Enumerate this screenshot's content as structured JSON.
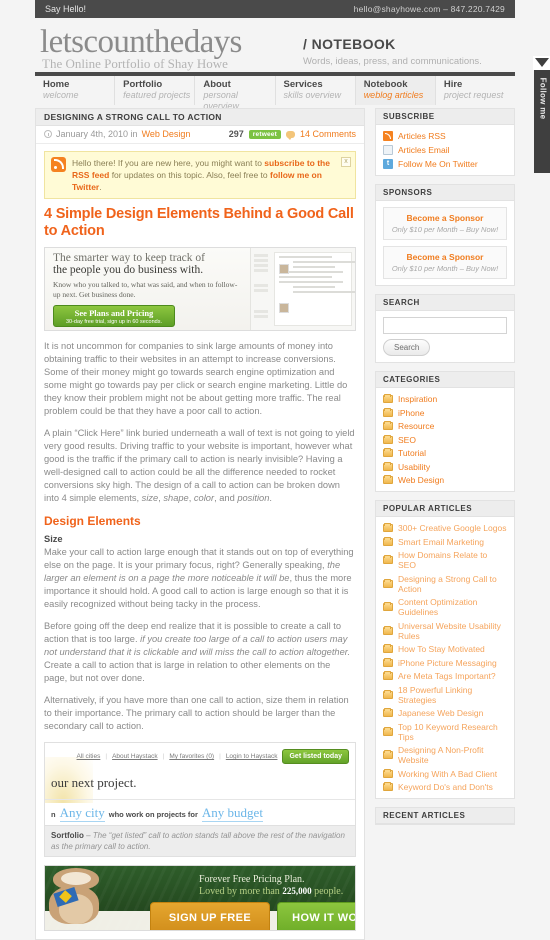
{
  "topbar": {
    "hello": "Say Hello!",
    "contact": "hello@shayhowe.com  –  847.220.7429"
  },
  "masthead": {
    "brand": "letscounthedays",
    "tagline": "The Online Portfolio of Shay Howe",
    "section": "/ NOTEBOOK",
    "section_desc": "Words, ideas, press, and communications."
  },
  "nav": {
    "items": [
      {
        "title": "Home",
        "sub": "welcome",
        "active": false
      },
      {
        "title": "Portfolio",
        "sub": "featured projects",
        "active": false
      },
      {
        "title": "About",
        "sub": "personal overview",
        "active": false
      },
      {
        "title": "Services",
        "sub": "skills overview",
        "active": false
      },
      {
        "title": "Notebook",
        "sub": "weblog articles",
        "active": true
      },
      {
        "title": "Hire",
        "sub": "project request",
        "active": false
      }
    ]
  },
  "follow_tab": {
    "label": "Follow me",
    "icon": "twitter-bird-icon"
  },
  "article": {
    "breadcrumb_title": "DESIGNING A STRONG CALL TO ACTION",
    "date": "January 4th, 2010 in",
    "category": "Web Design",
    "retweet_count": "297",
    "retweet_label": "retweet",
    "comments": "14 Comments",
    "rss_notice_pre": "Hello there! If you are new here, you might want to ",
    "rss_notice_link1": "subscribe to the RSS feed",
    "rss_notice_mid": " for updates on this topic. Also, feel free to ",
    "rss_notice_link2": "follow me on Twitter",
    "rss_notice_end": ".",
    "rss_close": "x",
    "title": "4 Simple Design Elements Behind a Good Call to Action",
    "hero": {
      "headline_dim": "The smarter way to keep track of",
      "headline": "the people you do business with.",
      "paragraph": "Know who you talked to, what was said, and when to follow-up next. Get business done.",
      "cta_title": "See Plans and Pricing",
      "cta_sub": "30-day free trial, sign up in 60 seconds."
    },
    "p1": "It is not uncommon for companies to sink large amounts of money into obtaining traffic to their websites in an attempt to increase conversions. Some of their money might go towards search engine optimization and some might go towards pay per click or search engine marketing. Little do they know their problem might not be about getting more traffic. The real problem could be that they have a poor call to action.",
    "p2_a": "A plain “Click Here” link buried underneath a wall of text is not going to yield very good results. Driving traffic to your website is important, however what good is the traffic if the primary call to action is nearly invisible? Having a well-designed call to action could be all the difference needed to rocket conversions sky high. The design of a call to action can be broken down into 4 simple elements, ",
    "p2_i1": "size",
    "p2_c1": ", ",
    "p2_i2": "shape",
    "p2_c2": ", ",
    "p2_i3": "color",
    "p2_c3": ", and ",
    "p2_i4": "position",
    "p2_end": ".",
    "h2_design_elements": "Design Elements",
    "h3_size": "Size",
    "p3_a": "Make your call to action large enough that it stands out on top of everything else on the page. It is your primary focus, right? Generally speaking, ",
    "p3_i": "the larger an element is on a page the more noticeable it will be",
    "p3_b": ", thus the more importance it should hold. A good call to action is large enough so that it is easily recognized without being tacky in the process.",
    "p4_a": "Before going off the deep end realize that it is possible to create a call to action that is too large. ",
    "p4_i": "if you create too large of a call to action users may not understand that it is clickable and will miss the call to action altogether.",
    "p4_b": " Create a call to action that is large in relation to other elements on the page, but not over done.",
    "p5": "Alternatively, if you have more than one call to action, size them in relation to their importance. The primary call to action should be larger than the secondary call to action.",
    "haystack": {
      "links": [
        "All cities",
        "About Haystack",
        "My favorites (0)",
        "Login to Haystack"
      ],
      "button": "Get listed today",
      "headline": "our next project.",
      "pre": "n",
      "blue1": "Any city",
      "mid": "who work on projects for",
      "blue2": "Any budget",
      "caption_strong": "Sortfolio",
      "caption_rest": " – The “get listed” call to action stands tall above the rest of the navigation as the primary call to action."
    },
    "mailchimp": {
      "line1": "Forever Free Pricing Plan.",
      "line2_pre": "Loved by more than ",
      "line2_num": "225,000",
      "line2_post": " people.",
      "btn1": "SIGN UP FREE",
      "btn2": "HOW IT WORKS"
    }
  },
  "sidebar": {
    "subscribe": {
      "title": "SUBSCRIBE",
      "items": [
        {
          "label": "Articles RSS",
          "icon": "rss-icon"
        },
        {
          "label": "Articles Email",
          "icon": "mail-icon"
        },
        {
          "label": "Follow Me On Twitter",
          "icon": "twitter-icon"
        }
      ]
    },
    "sponsors": {
      "title": "SPONSORS",
      "items": [
        {
          "title": "Become a Sponsor",
          "sub": "Only $10 per Month – Buy Now!"
        },
        {
          "title": "Become a Sponsor",
          "sub": "Only $10 per Month – Buy Now!"
        }
      ]
    },
    "search": {
      "title": "SEARCH",
      "value": "",
      "placeholder": "",
      "button": "Search"
    },
    "categories": {
      "title": "CATEGORIES",
      "items": [
        "Inspiration",
        "iPhone",
        "Resource",
        "SEO",
        "Tutorial",
        "Usability",
        "Web Design"
      ]
    },
    "popular": {
      "title": "POPULAR ARTICLES",
      "items": [
        "300+ Creative Google Logos",
        "Smart Email Marketing",
        "How Domains Relate to SEO",
        "Designing a Strong Call to Action",
        "Content Optimization Guidelines",
        "Universal Website Usability Rules",
        "How To Stay Motivated",
        "iPhone Picture Messaging",
        "Are Meta Tags Important?",
        "18 Powerful Linking Strategies",
        "Japanese Web Design",
        "Top 10 Keyword Research Tips",
        "Designing A Non-Profit Website",
        "Working With A Bad Client",
        "Keyword Do's and Don'ts"
      ]
    },
    "recent": {
      "title": "RECENT ARTICLES"
    }
  },
  "colors": {
    "accent": "#f0631b",
    "dark": "#4a4a4a",
    "green": "#7cc242"
  }
}
